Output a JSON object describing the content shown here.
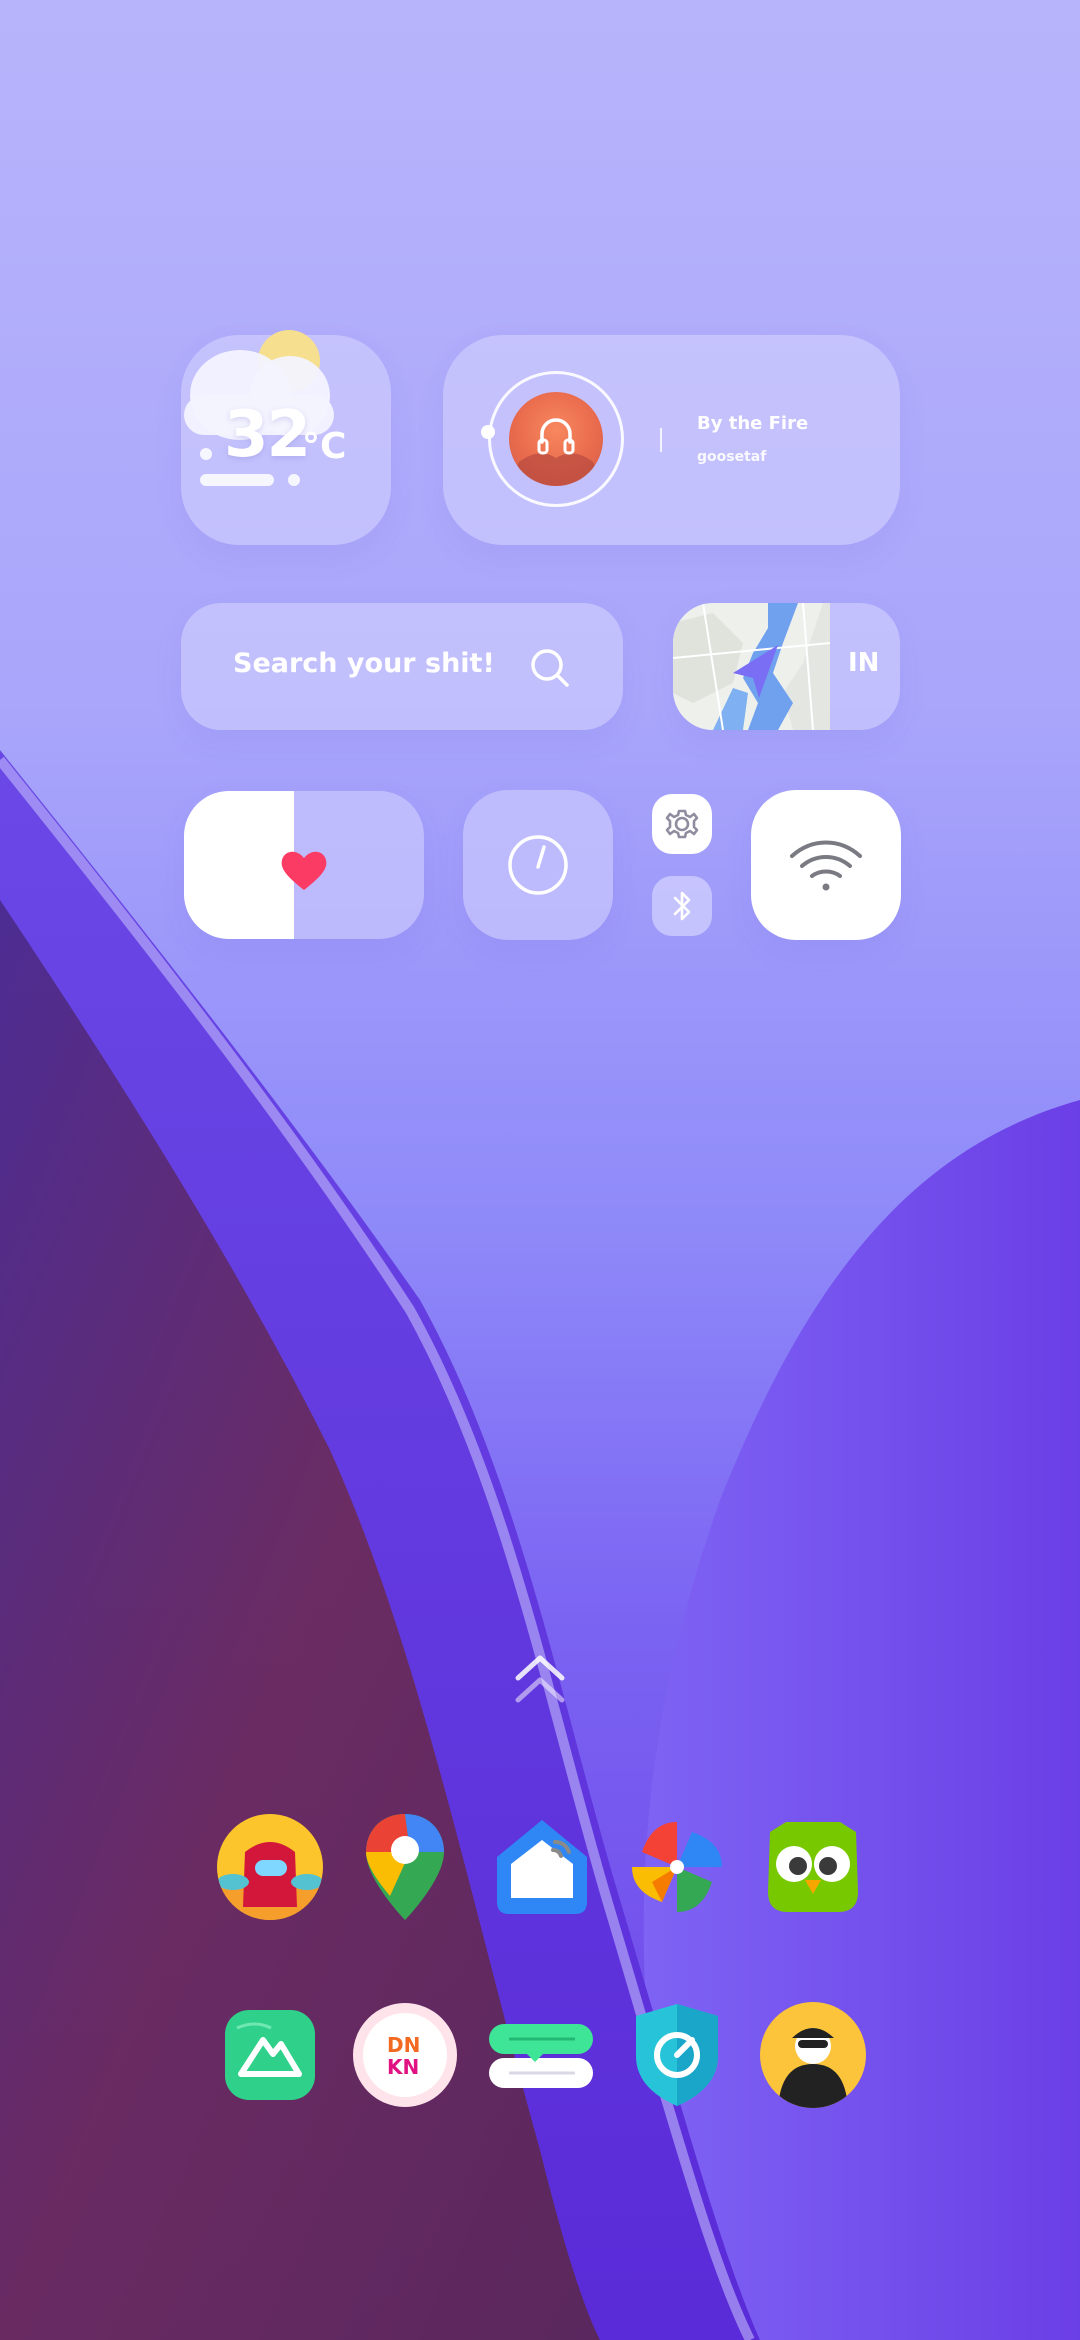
{
  "weather": {
    "temperature": "32",
    "unit": "°C"
  },
  "music": {
    "title": "By the Fire",
    "artist": "goosetaf"
  },
  "search": {
    "placeholder": "Search your shit!"
  },
  "map": {
    "country_code": "IN"
  },
  "colors": {
    "heart": "#fb3b63",
    "accent": "#7a6ef5",
    "widget": "#d6d4ff"
  },
  "icons": {
    "top_row": [
      "among-us-icon",
      "google-maps-icon",
      "home-icon",
      "pinwheel-icon",
      "duolingo-owl-icon"
    ],
    "bottom_row": [
      "alltrails-icon",
      "dunkin-icon",
      "chat-bubbles-icon",
      "vpn-shield-icon",
      "incognito-avatar-icon"
    ]
  }
}
